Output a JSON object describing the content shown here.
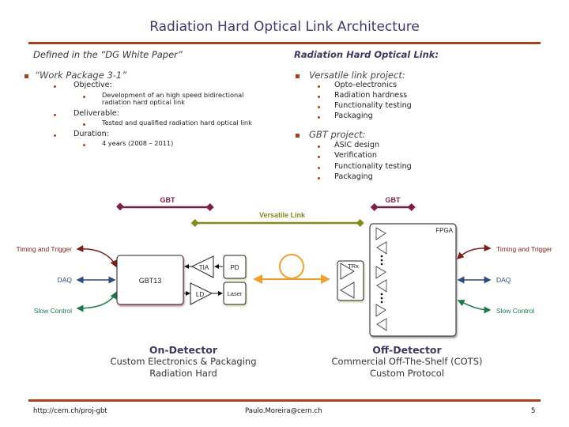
{
  "slide": {
    "title": "Radiation Hard Optical Link Architecture",
    "left": {
      "intro": "Defined in the “DG White Paper”",
      "work_package": "“Work Package 3-1”",
      "items": [
        {
          "label": "Objective:",
          "sub": [
            "Development of an high speed bidirectional",
            "radiation hard optical link"
          ]
        },
        {
          "label": "Deliverable:",
          "sub": [
            "Tested and qualified radiation hard optical link"
          ]
        },
        {
          "label": "Duration:",
          "sub": [
            "4 years (2008 – 2011)"
          ]
        }
      ]
    },
    "right": {
      "heading": "Radiation Hard Optical Link:",
      "projects": [
        {
          "label": "Versatile link project:",
          "items": [
            "Opto-electronics",
            "Radiation hardness",
            "Functionality testing",
            "Packaging"
          ]
        },
        {
          "label": "GBT project:",
          "items": [
            "ASIC design",
            "Verification",
            "Functionality testing",
            "Packaging"
          ]
        }
      ]
    },
    "diagram": {
      "gbt_left_label": "GBT",
      "gbt_right_label": "GBT",
      "versatile_link_label": "Versatile Link",
      "left_signals": [
        "Timing and Trigger",
        "DAQ",
        "Slow Control"
      ],
      "right_signals": [
        "Timing and Trigger",
        "DAQ",
        "Slow Control"
      ],
      "gbt13_label": "GBT13",
      "tia_label": "TIA",
      "ld_label": "LD",
      "pd_label": "PD",
      "laser_label": "Laser",
      "trx_label": "TRx",
      "fpga_label": "FPGA",
      "colors": {
        "gbt": "#7a1f4a",
        "versatile": "#858a1e",
        "timing": "#7a1f1a",
        "daq": "#2a4a80",
        "slow": "#1f7a4a",
        "fiber": "#f0a030"
      }
    },
    "captions": {
      "on_detector": {
        "title": "On-Detector",
        "lines": [
          "Custom Electronics & Packaging",
          "Radiation Hard"
        ]
      },
      "off_detector": {
        "title": "Off-Detector",
        "lines": [
          "Commercial Off-The-Shelf (COTS)",
          "Custom Protocol"
        ]
      }
    },
    "footer": {
      "url": "http://cern.ch/proj-gbt",
      "email": "Paulo.Moreira@cern.ch",
      "page": "5"
    }
  }
}
